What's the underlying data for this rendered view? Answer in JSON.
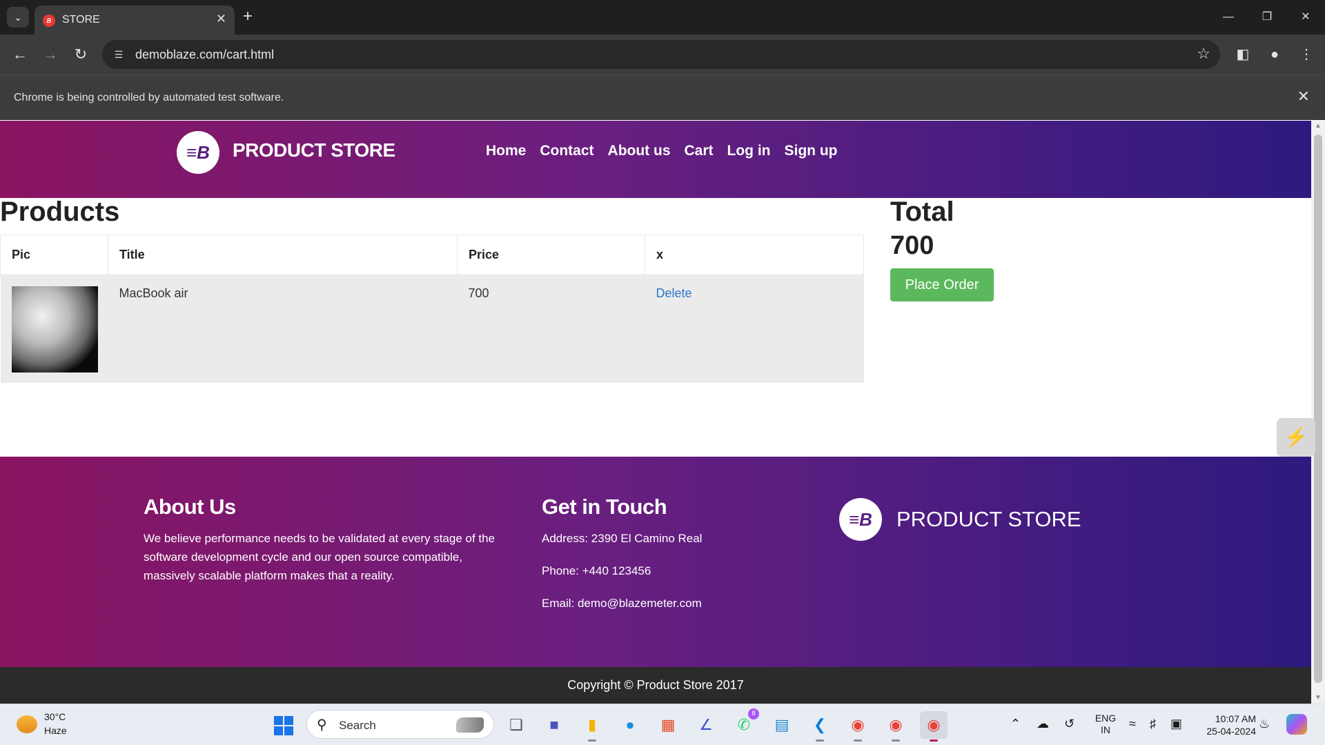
{
  "browser": {
    "tab_title": "STORE",
    "tab_favicon_text": "B",
    "url": "demoblaze.com/cart.html",
    "infobar_text": "Chrome is being controlled by automated test software."
  },
  "site": {
    "brand": "PRODUCT STORE",
    "nav": [
      "Home",
      "Contact",
      "About us",
      "Cart",
      "Log in",
      "Sign up"
    ]
  },
  "cart": {
    "heading": "Products",
    "columns": [
      "Pic",
      "Title",
      "Price",
      "x"
    ],
    "rows": [
      {
        "title": "MacBook air",
        "price": "700",
        "action": "Delete"
      }
    ],
    "total_label": "Total",
    "total_value": "700",
    "place_order": "Place Order"
  },
  "footer": {
    "about_heading": "About Us",
    "about_text": "We believe performance needs to be validated at every stage of the software development cycle and our open source compatible, massively scalable platform makes that a reality.",
    "contact_heading": "Get in Touch",
    "address": "Address: 2390 El Camino Real",
    "phone": "Phone: +440 123456",
    "email": "Email: demo@blazemeter.com",
    "brand": "PRODUCT STORE",
    "copyright": "Copyright © Product Store 2017"
  },
  "taskbar": {
    "weather_temp": "30°C",
    "weather_desc": "Haze",
    "search_label": "Search",
    "whatsapp_badge": "8",
    "lang_line1": "ENG",
    "lang_line2": "IN",
    "time": "10:07 AM",
    "date": "25-04-2024"
  },
  "icons": {
    "tab_search": "chevron-down-icon",
    "tab_close": "close-icon",
    "new_tab": "plus-icon",
    "back": "arrow-left-icon",
    "forward": "arrow-right-icon",
    "reload": "reload-icon",
    "bookmark": "star-icon",
    "profile": "person-icon"
  },
  "colors": {
    "header_gradient_start": "#8a1461",
    "header_gradient_end": "#2d1a80",
    "place_order_button": "#5cb85c",
    "delete_link": "#2a77c9"
  }
}
